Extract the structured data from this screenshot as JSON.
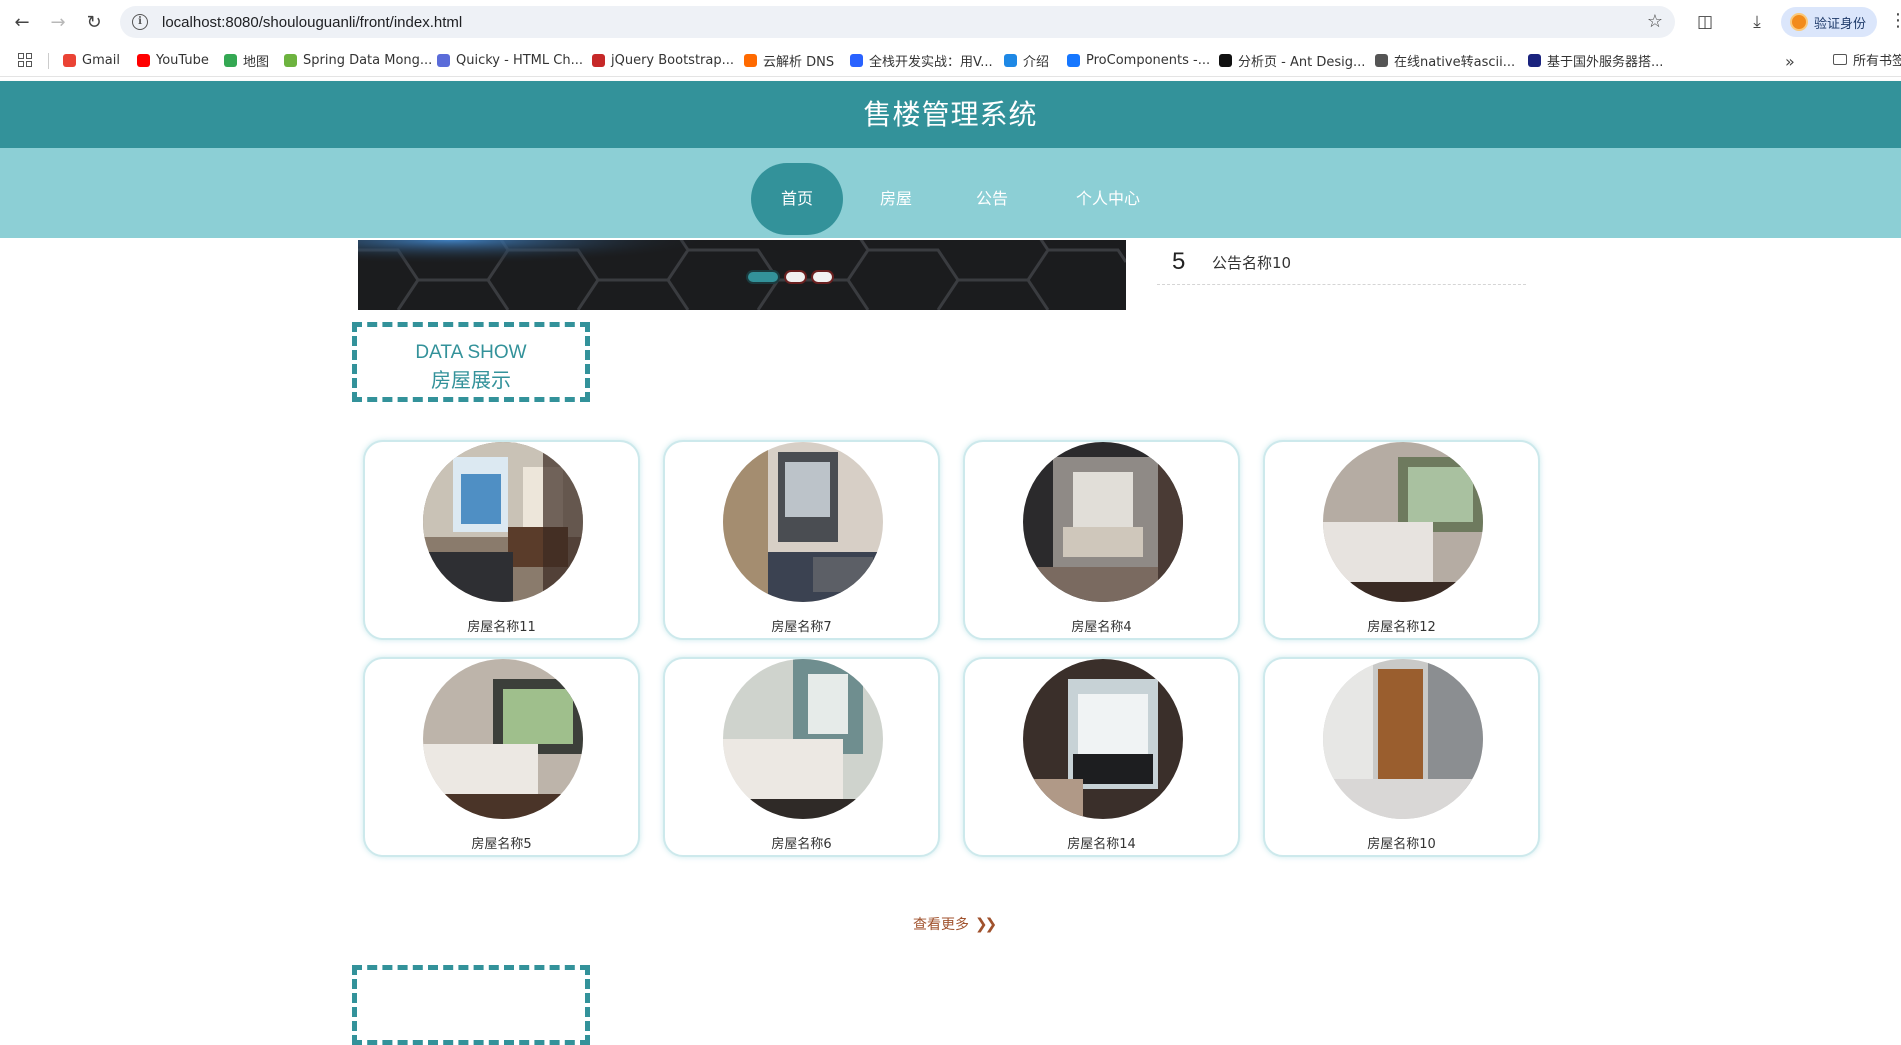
{
  "browser": {
    "url": "localhost:8080/shoulouguanli/front/index.html",
    "profile_label": "验证身份",
    "bookmarks": [
      {
        "label": "Gmail",
        "icon": "gmail-icon",
        "color": "#ea4335"
      },
      {
        "label": "YouTube",
        "icon": "youtube-icon",
        "color": "#ff0000"
      },
      {
        "label": "地图",
        "icon": "maps-icon",
        "color": "#34a853"
      },
      {
        "label": "Spring Data Mong...",
        "icon": "spring-icon",
        "color": "#6db33f"
      },
      {
        "label": "Quicky - HTML Ch...",
        "icon": "quicky-icon",
        "color": "#5b6cd9"
      },
      {
        "label": "jQuery Bootstrap...",
        "icon": "jquery-icon",
        "color": "#c62828"
      },
      {
        "label": "云解析 DNS",
        "icon": "dns-icon",
        "color": "#ff6a00"
      },
      {
        "label": "全栈开发实战：用V...",
        "icon": "m-icon",
        "color": "#2962ff"
      },
      {
        "label": "介绍",
        "icon": "intro-icon",
        "color": "#1e88e5"
      },
      {
        "label": "ProComponents -...",
        "icon": "procomponents-icon",
        "color": "#1677ff"
      },
      {
        "label": "分析页 - Ant Desig...",
        "icon": "pro-icon",
        "color": "#111111"
      },
      {
        "label": "在线native转ascii...",
        "icon": "globe-icon",
        "color": "#555555"
      },
      {
        "label": "基于国外服务器搭...",
        "icon": "server-icon",
        "color": "#1a237e"
      }
    ],
    "bookmarks_folder": "所有书签"
  },
  "site": {
    "title": "售楼管理系统",
    "nav": [
      "首页",
      "房屋",
      "公告",
      "个人中心"
    ],
    "active_nav": "首页",
    "accent_color": "#33929a"
  },
  "notices": [
    {
      "number": "5",
      "title": "公告名称10"
    }
  ],
  "banner": {
    "dot_count": 3,
    "active_dot": 0
  },
  "house_section": {
    "title_en": "DATA SHOW",
    "title_cn": "房屋展示",
    "houses": [
      {
        "name": "房屋名称11"
      },
      {
        "name": "房屋名称7"
      },
      {
        "name": "房屋名称4"
      },
      {
        "name": "房屋名称12"
      },
      {
        "name": "房屋名称5"
      },
      {
        "name": "房屋名称6"
      },
      {
        "name": "房屋名称14"
      },
      {
        "name": "房屋名称10"
      }
    ],
    "more_label": "查看更多"
  }
}
